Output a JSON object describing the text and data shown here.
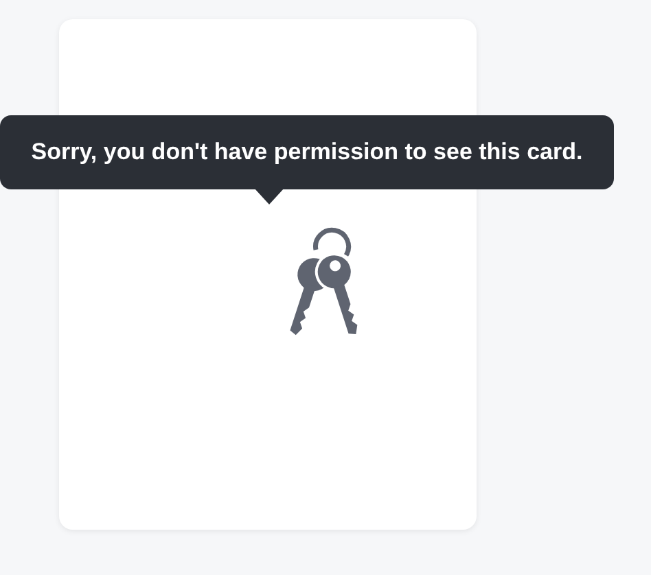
{
  "tooltip": {
    "text": "Sorry, you don't have permission to see this card."
  }
}
